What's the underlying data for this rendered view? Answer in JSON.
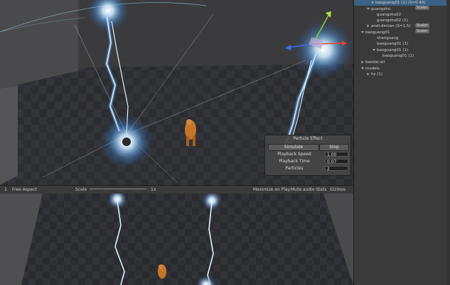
{
  "particle_panel": {
    "title": "Particle Effect",
    "simulate_label": "Simulate",
    "stop_label": "Stop",
    "playback_speed_label": "Playback Speed",
    "playback_speed_value": "1.00",
    "playback_time_label": "Playback Time",
    "playback_time_value": "0.07",
    "particles_label": "Particles",
    "particles_value": "2"
  },
  "game_toolbar": {
    "display": "1",
    "aspect": "Free Aspect",
    "scale_label": "Scale",
    "scale_value": "1x",
    "maximize_label": "Maximize on Play",
    "mute_label": "Mute audio",
    "stats_label": "Stats",
    "gizmos_label": "Gizmos"
  },
  "hierarchy": {
    "items": [
      {
        "label": "baoguang01 (1)",
        "suffix": "(S=0.40)",
        "selected": true
      },
      {
        "label": "guangzhu",
        "tag": "Scaler"
      },
      {
        "label": "guangzhu02"
      },
      {
        "label": "guangzhu02 (1)"
      },
      {
        "label": "andi-dimian",
        "suffix": "(S=1.5)",
        "tag": "Scaler"
      },
      {
        "label": "baoguang01",
        "tag": "Scaler"
      },
      {
        "label": "shanguang"
      },
      {
        "label": "baoguang01 (1)"
      },
      {
        "label": "baoguang01 (1)"
      },
      {
        "label": "baoguang01 (1)"
      },
      {
        "label": "baodai-all"
      },
      {
        "label": "models"
      },
      {
        "label": "hz (1)"
      }
    ]
  },
  "colors": {
    "selection": "#3d6184",
    "editor_bg": "#3a3a3a",
    "glow": "#9fd4ff"
  }
}
